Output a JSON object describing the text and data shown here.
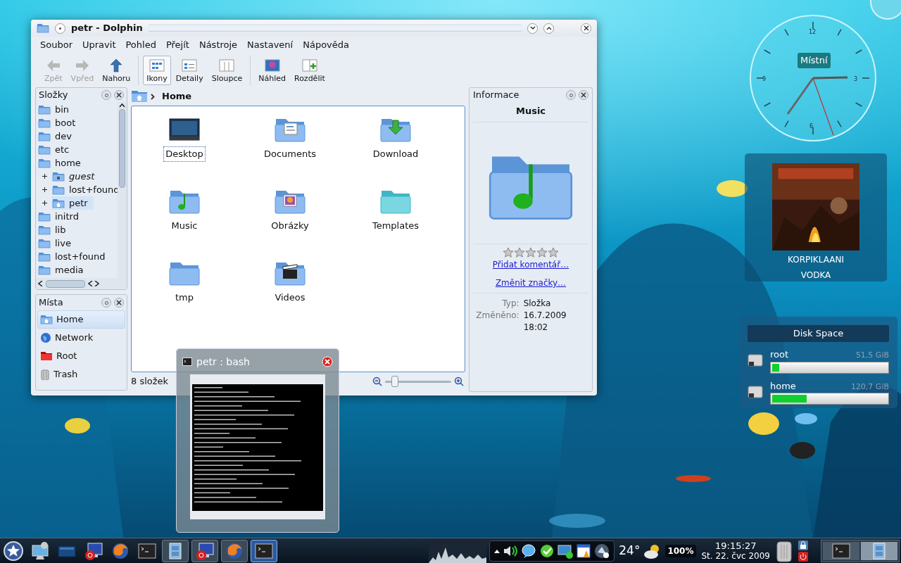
{
  "dolphin": {
    "title": "petr - Dolphin",
    "menu": [
      "Soubor",
      "Upravit",
      "Pohled",
      "Přejít",
      "Nástroje",
      "Nastavení",
      "Nápověda"
    ],
    "toolbar_groups": [
      [
        {
          "label": "Zpět",
          "kind": "back",
          "disabled": true,
          "selected": false
        },
        {
          "label": "Vpřed",
          "kind": "forward",
          "disabled": true,
          "selected": false
        },
        {
          "label": "Nahoru",
          "kind": "up",
          "disabled": false,
          "selected": false
        }
      ],
      [
        {
          "label": "Ikony",
          "kind": "icons",
          "disabled": false,
          "selected": true
        },
        {
          "label": "Detaily",
          "kind": "details",
          "disabled": false,
          "selected": false
        },
        {
          "label": "Sloupce",
          "kind": "columns",
          "disabled": false,
          "selected": false
        }
      ],
      [
        {
          "label": "Náhled",
          "kind": "preview",
          "disabled": false,
          "selected": false
        },
        {
          "label": "Rozdělit",
          "kind": "split",
          "disabled": false,
          "selected": false
        }
      ]
    ],
    "folders_panel": {
      "title": "Složky",
      "items": [
        {
          "label": "bin",
          "selected": false
        },
        {
          "label": "boot",
          "selected": false
        },
        {
          "label": "dev",
          "selected": false
        },
        {
          "label": "etc",
          "selected": false
        },
        {
          "label": "home",
          "selected": false,
          "children": [
            {
              "label": "guest",
              "italic": true,
              "kind": "locked",
              "selected": false
            },
            {
              "label": "lost+found",
              "italic": false,
              "kind": "folder",
              "selected": false
            },
            {
              "label": "petr",
              "italic": false,
              "kind": "home",
              "selected": true
            }
          ]
        },
        {
          "label": "initrd",
          "selected": false
        },
        {
          "label": "lib",
          "selected": false
        },
        {
          "label": "live",
          "selected": false
        },
        {
          "label": "lost+found",
          "selected": false
        },
        {
          "label": "media",
          "selected": false
        }
      ]
    },
    "places_panel": {
      "title": "Místa",
      "items": [
        {
          "label": "Home",
          "kind": "home",
          "selected": true
        },
        {
          "label": "Network",
          "kind": "network",
          "selected": false
        },
        {
          "label": "Root",
          "kind": "root",
          "selected": false
        },
        {
          "label": "Trash",
          "kind": "trash",
          "selected": false
        }
      ]
    },
    "breadcrumb": "Home",
    "files": [
      {
        "label": "Desktop",
        "kind": "desktop",
        "focused": true
      },
      {
        "label": "Documents",
        "kind": "documents",
        "focused": false
      },
      {
        "label": "Download",
        "kind": "download",
        "focused": false
      },
      {
        "label": "Music",
        "kind": "music",
        "focused": false
      },
      {
        "label": "Obrázky",
        "kind": "pictures",
        "focused": false
      },
      {
        "label": "Templates",
        "kind": "templates",
        "focused": false
      },
      {
        "label": "tmp",
        "kind": "folder",
        "focused": false
      },
      {
        "label": "Videos",
        "kind": "videos",
        "focused": false
      }
    ],
    "status": "8 složek",
    "zoom": {
      "level": 0.15
    },
    "info_panel": {
      "title": "Informace",
      "name": "Music",
      "stars": 0,
      "links": [
        "Přidat komentář…",
        "Změnit značky…"
      ],
      "fields": [
        {
          "label": "Typ:",
          "value": "Složka"
        },
        {
          "label": "Změněno:",
          "value": "16.7.2009 18:02"
        }
      ]
    }
  },
  "terminal_preview": {
    "title": "petr : bash"
  },
  "clock": {
    "label": "Místní",
    "numerals": [
      "12",
      "3",
      "6",
      "9"
    ]
  },
  "now_playing": {
    "artist": "KORPIKLAANI",
    "title": "VODKA"
  },
  "disk_space": {
    "title": "Disk Space",
    "disks": [
      {
        "name": "root",
        "size": "51,5 GiB",
        "level": 0.06
      },
      {
        "name": "home",
        "size": "120,7 GiB",
        "level": 0.3
      }
    ]
  },
  "taskbar": {
    "launchers": [
      {
        "kind": "menu"
      },
      {
        "kind": "device"
      },
      {
        "kind": "monitor"
      },
      {
        "kind": "remote"
      },
      {
        "kind": "browser"
      },
      {
        "kind": "terminal"
      }
    ],
    "tasks": [
      {
        "kind": "files",
        "selected": false
      },
      {
        "kind": "remote",
        "selected": false
      },
      {
        "kind": "browser",
        "selected": false
      },
      {
        "kind": "terminal",
        "selected": true
      }
    ],
    "tray": [
      {
        "kind": "volume"
      },
      {
        "kind": "chat"
      },
      {
        "kind": "messenger"
      },
      {
        "kind": "network"
      },
      {
        "kind": "calendar"
      },
      {
        "kind": "update"
      }
    ],
    "temperature": "24°",
    "battery": "100%",
    "time": "19:15:27",
    "date": "St. 22. čvc 2009"
  }
}
